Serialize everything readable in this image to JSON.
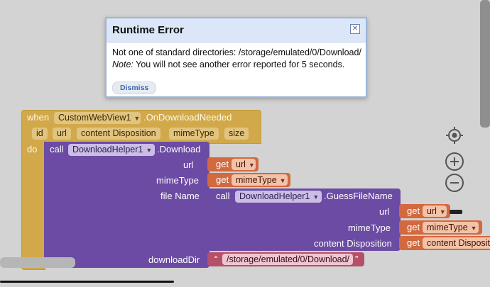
{
  "dialog": {
    "title": "Runtime Error",
    "message_line1": "Not one of standard directories: /storage/emulated/0/Download/",
    "note_label": "Note:",
    "message_line2": " You will not see another error reported for 5 seconds.",
    "dismiss_label": "Dismiss",
    "close_icon": "close-icon"
  },
  "event_block": {
    "when": "when",
    "component": "CustomWebView1",
    "event": ".OnDownloadNeeded",
    "params": [
      "id",
      "url",
      "content Disposition",
      "mimeType",
      "size"
    ],
    "do": "do"
  },
  "call_block": {
    "call": "call",
    "component": "DownloadHelper1",
    "method": ".Download",
    "args": {
      "url": "url",
      "mimeType": "mimeType",
      "fileName": "file Name",
      "downloadDir": "downloadDir"
    }
  },
  "get_url": {
    "get": "get",
    "var": "url"
  },
  "get_mime": {
    "get": "get",
    "var": "mimeType"
  },
  "guess_block": {
    "call": "call",
    "component": "DownloadHelper1",
    "method": ".GuessFileName",
    "args": {
      "url": "url",
      "mimeType": "mimeType",
      "contentDisposition": "content Disposition"
    },
    "get_url": {
      "get": "get",
      "var": "url"
    },
    "get_mime": {
      "get": "get",
      "var": "mimeType"
    },
    "get_cd": {
      "get": "get",
      "var": "content Disposit"
    }
  },
  "text_block": {
    "open_quote": "“",
    "value": "/storage/emulated/0/Download/",
    "close_quote": "”"
  },
  "controls": {
    "locate_icon": "crosshair-icon",
    "zoom_in_icon": "plus-icon",
    "zoom_out_icon": "minus-icon"
  },
  "colors": {
    "event": "#d1a94b",
    "procedure": "#6b4ba3",
    "getter": "#d2693f",
    "text": "#b5506a",
    "dialog_header": "#dbe6f8"
  }
}
